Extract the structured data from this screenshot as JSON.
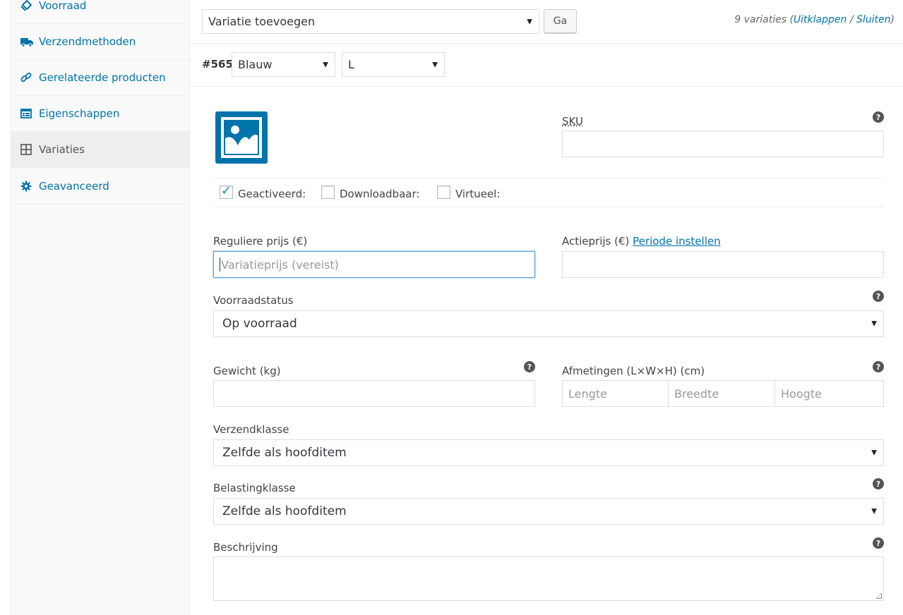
{
  "sidebar": {
    "items": [
      {
        "label": "Voorraad",
        "icon": "inventory-icon"
      },
      {
        "label": "Verzendmethoden",
        "icon": "truck-icon"
      },
      {
        "label": "Gerelateerde producten",
        "icon": "link-icon"
      },
      {
        "label": "Eigenschappen",
        "icon": "list-icon"
      },
      {
        "label": "Variaties",
        "icon": "grid-icon"
      },
      {
        "label": "Geavanceerd",
        "icon": "gear-icon"
      }
    ],
    "active": "Variaties"
  },
  "toolbar": {
    "add_variation_select": "Variatie toevoegen",
    "go_button": "Ga",
    "count_text": "9 variaties (",
    "expand_link": "Uitklappen",
    "separator": " / ",
    "close_link": "Sluiten",
    "count_close": ")"
  },
  "variation": {
    "id": "#565",
    "color_select": "Blauw",
    "size_select": "L"
  },
  "form": {
    "sku_label": "SKU",
    "enabled_label": "Geactiveerd:",
    "enabled_checked": true,
    "downloadable_label": "Downloadbaar:",
    "virtual_label": "Virtueel:",
    "regular_price_label": "Reguliere prijs (€)",
    "regular_price_placeholder": "Variatieprijs (vereist)",
    "sale_price_label": "Actieprijs (€)",
    "sale_schedule_link": "Periode instellen",
    "stock_status_label": "Voorraadstatus",
    "stock_status_value": "Op voorraad",
    "weight_label": "Gewicht (kg)",
    "dimensions_label": "Afmetingen (L×W×H) (cm)",
    "length_placeholder": "Lengte",
    "width_placeholder": "Breedte",
    "height_placeholder": "Hoogte",
    "shipping_class_label": "Verzendklasse",
    "shipping_class_value": "Zelfde als hoofditem",
    "tax_class_label": "Belastingklasse",
    "tax_class_value": "Zelfde als hoofditem",
    "description_label": "Beschrijving"
  },
  "colors": {
    "link": "#0073aa",
    "focus_border": "#5b9dd9"
  }
}
